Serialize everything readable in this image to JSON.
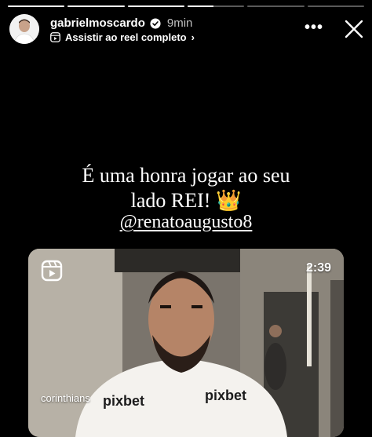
{
  "story": {
    "progress_fill": [
      1,
      1,
      1,
      0.45,
      0,
      0
    ]
  },
  "header": {
    "username": "gabrielmoscardo",
    "time_ago": "9min",
    "reel_link_label": "Assistir ao reel completo",
    "reel_link_chevron": "›",
    "more_label": "•••"
  },
  "caption": {
    "line1": "É uma honra jogar ao seu",
    "line2": "lado REI! 👑",
    "mention": "@renatoaugusto8"
  },
  "reel": {
    "duration": "2:39",
    "source": "corinthians",
    "shirt_text": "pixbet"
  },
  "icons": {
    "verified": "verified-badge-icon",
    "reel": "reels-icon",
    "close": "close-icon"
  },
  "colors": {
    "background": "#000000",
    "verified": "#3897f0"
  }
}
